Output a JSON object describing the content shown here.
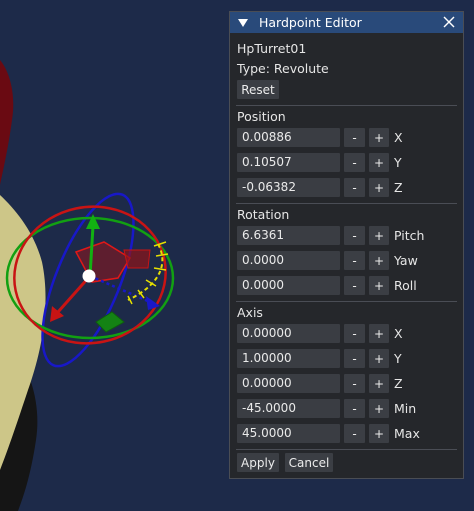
{
  "editor": {
    "title": "Hardpoint Editor",
    "name": "HpTurret01",
    "type": "Type: Revolute",
    "reset": "Reset",
    "minus": "-",
    "plus": "+",
    "position": {
      "label": "Position",
      "rows": [
        {
          "value": "0.00886",
          "axis": "X"
        },
        {
          "value": "0.10507",
          "axis": "Y"
        },
        {
          "value": "-0.06382",
          "axis": "Z"
        }
      ]
    },
    "rotation": {
      "label": "Rotation",
      "rows": [
        {
          "value": "6.6361",
          "axis": "Pitch"
        },
        {
          "value": "0.0000",
          "axis": "Yaw"
        },
        {
          "value": "0.0000",
          "axis": "Roll"
        }
      ]
    },
    "axis": {
      "label": "Axis",
      "rows": [
        {
          "value": "0.00000",
          "axis": "X"
        },
        {
          "value": "1.00000",
          "axis": "Y"
        },
        {
          "value": "0.00000",
          "axis": "Z"
        },
        {
          "value": "-45.0000",
          "axis": "Min"
        },
        {
          "value": "45.0000",
          "axis": "Max"
        }
      ]
    },
    "apply": "Apply",
    "cancel": "Cancel"
  },
  "icons": {
    "collapse": "triangle-down-icon",
    "close": "close-icon"
  },
  "colors": {
    "viewport_bg": "#1d2a49",
    "panel_bg": "#25272b",
    "titlebar_bg": "#294a7a",
    "field_bg": "#3a3d43",
    "button_bg": "#3b3e44",
    "gizmo_red": "#c81414",
    "gizmo_green": "#12a012",
    "gizmo_blue": "#1818c8",
    "gizmo_yellow": "#e6e000"
  }
}
